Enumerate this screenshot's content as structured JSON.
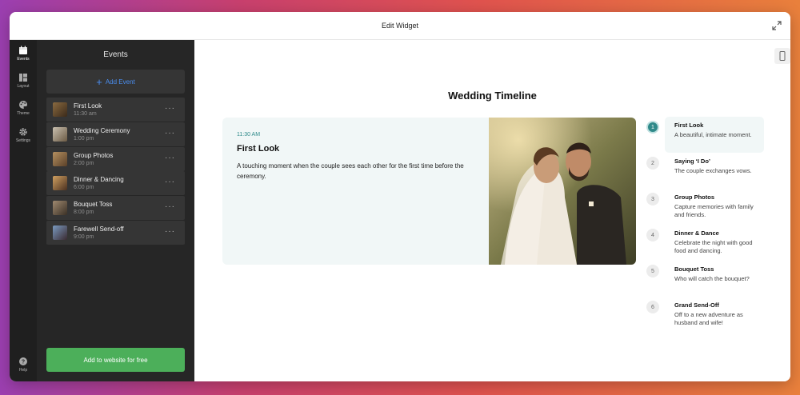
{
  "window": {
    "title": "Edit Widget"
  },
  "rail": {
    "items": [
      {
        "label": "Events",
        "icon": "calendar-icon",
        "active": true
      },
      {
        "label": "Layout",
        "icon": "layout-icon",
        "active": false
      },
      {
        "label": "Theme",
        "icon": "palette-icon",
        "active": false
      },
      {
        "label": "Settings",
        "icon": "gear-icon",
        "active": false
      }
    ],
    "help_label": "Help"
  },
  "panel": {
    "title": "Events",
    "add_label": "Add Event",
    "events": [
      {
        "name": "First Look",
        "time": "11:30 am"
      },
      {
        "name": "Wedding Ceremony",
        "time": "1:00 pm"
      },
      {
        "name": "Group Photos",
        "time": "2:00 pm"
      },
      {
        "name": "Dinner & Dancing",
        "time": "6:00 pm"
      },
      {
        "name": "Bouquet Toss",
        "time": "8:00 pm"
      },
      {
        "name": "Farewell Send-off",
        "time": "9:00 pm"
      }
    ],
    "more_glyph": "···",
    "cta_label": "Add to website for free"
  },
  "widget": {
    "title": "Wedding Timeline",
    "featured": {
      "time": "11:30 AM",
      "title": "First Look",
      "description": "A touching moment when the couple sees each other for the first time before the ceremony."
    },
    "steps": [
      {
        "num": "1",
        "title": "First Look",
        "desc": "A beautiful, intimate moment."
      },
      {
        "num": "2",
        "title": "Saying ‘I Do’",
        "desc": "The couple exchanges vows."
      },
      {
        "num": "3",
        "title": "Group Photos",
        "desc": "Capture memories with family and friends."
      },
      {
        "num": "4",
        "title": "Dinner & Dance",
        "desc": "Celebrate the night with good food and dancing."
      },
      {
        "num": "5",
        "title": "Bouquet Toss",
        "desc": "Who will catch the bouquet?"
      },
      {
        "num": "6",
        "title": "Grand Send-Off",
        "desc": "Off to a new adventure as husband and wife!"
      }
    ]
  },
  "colors": {
    "accent": "#2f8a8a",
    "cta": "#4caf5a",
    "link": "#4a8ef0"
  }
}
